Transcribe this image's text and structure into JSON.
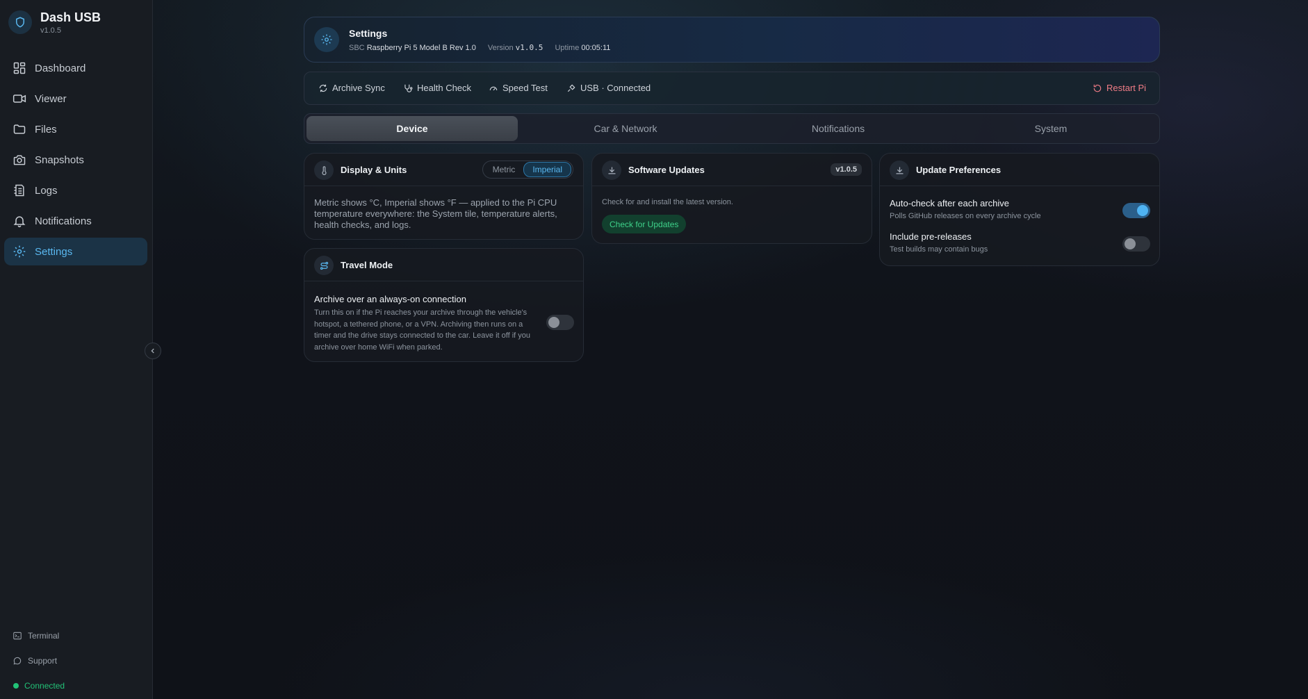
{
  "app": {
    "name": "Dash USB",
    "version": "v1.0.5"
  },
  "sidebar": {
    "items": [
      {
        "label": "Dashboard",
        "icon": "grid-icon"
      },
      {
        "label": "Viewer",
        "icon": "video-icon"
      },
      {
        "label": "Files",
        "icon": "folder-icon"
      },
      {
        "label": "Snapshots",
        "icon": "camera-icon"
      },
      {
        "label": "Logs",
        "icon": "logs-icon"
      },
      {
        "label": "Notifications",
        "icon": "bell-icon"
      },
      {
        "label": "Settings",
        "icon": "gear-icon",
        "active": true
      }
    ],
    "footer": {
      "terminal": "Terminal",
      "support": "Support",
      "status": "Connected"
    }
  },
  "header": {
    "title": "Settings",
    "sbc_label": "SBC",
    "sbc_value": "Raspberry Pi 5 Model B Rev 1.0",
    "version_label": "Version",
    "version_value": "v1.0.5",
    "uptime_label": "Uptime",
    "uptime_value": "00:05:11"
  },
  "toolbar": {
    "archive_sync": "Archive Sync",
    "health_check": "Health Check",
    "speed_test": "Speed Test",
    "usb_status": "USB · Connected",
    "restart": "Restart Pi"
  },
  "tabs": [
    "Device",
    "Car & Network",
    "Notifications",
    "System"
  ],
  "active_tab": "Device",
  "display_units": {
    "title": "Display & Units",
    "options": [
      "Metric",
      "Imperial"
    ],
    "selected": "Imperial",
    "description": "Metric shows °C, Imperial shows °F — applied to the Pi CPU temperature everywhere: the System tile, temperature alerts, health checks, and logs."
  },
  "travel_mode": {
    "title": "Travel Mode",
    "option_title": "Archive over an always-on connection",
    "option_desc": "Turn this on if the Pi reaches your archive through the vehicle's hotspot, a tethered phone, or a VPN. Archiving then runs on a timer and the drive stays connected to the car. Leave it off if you archive over home WiFi when parked.",
    "enabled": false
  },
  "software_updates": {
    "title": "Software Updates",
    "version_badge": "v1.0.5",
    "description": "Check for and install the latest version.",
    "button": "Check for Updates"
  },
  "update_prefs": {
    "title": "Update Preferences",
    "auto_check": {
      "title": "Auto-check after each archive",
      "sub": "Polls GitHub releases on every archive cycle",
      "enabled": true
    },
    "pre_releases": {
      "title": "Include pre-releases",
      "sub": "Test builds may contain bugs",
      "enabled": false
    }
  },
  "colors": {
    "accent": "#5ab8f0",
    "success": "#22c277",
    "danger": "#f07c86",
    "sidebar_bg": "#181c22"
  }
}
